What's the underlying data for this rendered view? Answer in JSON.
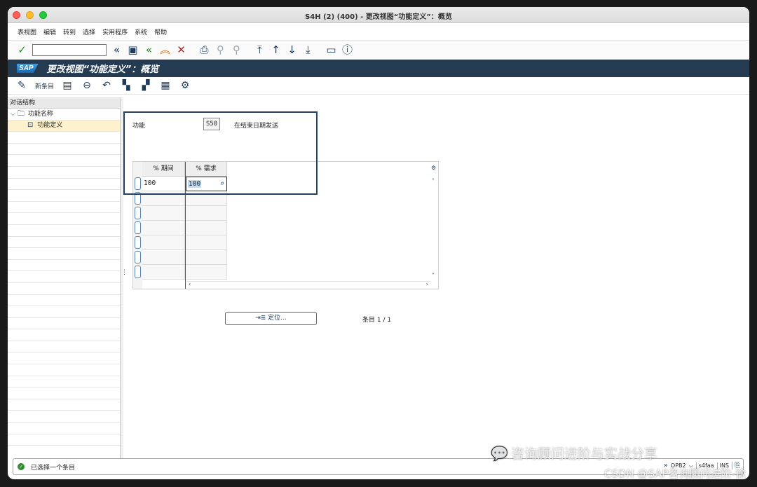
{
  "window": {
    "title": "S4H (2) (400) - 更改视图“功能定义”：概览"
  },
  "menu": [
    "表视图",
    "编辑",
    "转到",
    "选择",
    "实用程序",
    "系统",
    "帮助"
  ],
  "sap": {
    "logo": "SAP",
    "title": "更改视图“功能定义”：概览"
  },
  "toolbar2": {
    "new_entries": "新条目"
  },
  "tree": {
    "header": "对话结构",
    "folder": "功能名称",
    "item": "功能定义"
  },
  "detail": {
    "func_label": "功能",
    "func_value": "S50",
    "func_desc": "在结束日期发送"
  },
  "grid": {
    "columns": [
      "% 期间",
      "% 需求"
    ],
    "rows": [
      {
        "period": "100",
        "demand": "100"
      }
    ]
  },
  "position_button": "⇥≣ 定位...",
  "entry_count": "条目 1 / 1",
  "status": {
    "message": "已选择一个条目",
    "system": "OPB2",
    "server": "s4faa",
    "mode": "INS"
  },
  "watermark": {
    "line1": "咨询顾问进阶与实战分享",
    "line2": "CSDN @SAP咨询顾问进阶-徐"
  }
}
